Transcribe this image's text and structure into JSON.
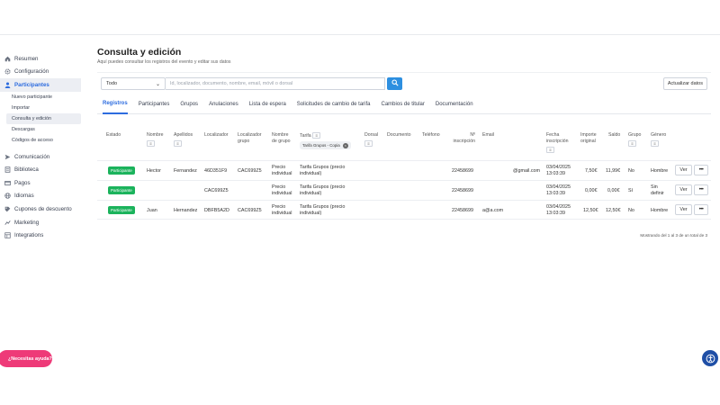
{
  "sidebar": {
    "items": [
      {
        "label": "Resumen",
        "icon": "home-icon"
      },
      {
        "label": "Configuración",
        "icon": "gear-icon"
      },
      {
        "label": "Participantes",
        "icon": "user-icon"
      }
    ],
    "sub_items": [
      "Nuevo participante",
      "Importar",
      "Consulta y edición",
      "Descargas",
      "Códigos de acceso"
    ],
    "items_bottom": [
      {
        "label": "Comunicación",
        "icon": "send-icon"
      },
      {
        "label": "Biblioteca",
        "icon": "book-icon"
      },
      {
        "label": "Pagos",
        "icon": "card-icon"
      },
      {
        "label": "Idiomas",
        "icon": "globe-icon"
      },
      {
        "label": "Cupones de descuento",
        "icon": "coupon-icon"
      },
      {
        "label": "Marketing",
        "icon": "chart-icon"
      },
      {
        "label": "Integrations",
        "icon": "grid-icon"
      }
    ]
  },
  "help_button": "¿Necesitas ayuda?",
  "page": {
    "title": "Consulta y edición",
    "subtitle": "Aquí puedes consultar los registros del evento y editar sus datos"
  },
  "search": {
    "select_value": "Todo",
    "placeholder": "Id, localizador, documento, nombre, email, móvil o dorsal",
    "refresh_label": "Actualizar datos"
  },
  "tabs": [
    "Registros",
    "Participantes",
    "Grupos",
    "Anulaciones",
    "Lista de espera",
    "Solicitudes de cambio de tarifa",
    "Cambios de titular",
    "Documentación"
  ],
  "table": {
    "headers": {
      "estado": "Estado",
      "nombre": "Nombre",
      "apellidos": "Apellidos",
      "localizador": "Localizador",
      "localizador_grupo_1": "Localizador",
      "localizador_grupo_2": "grupo",
      "nombre_grupo_1": "Nombre",
      "nombre_grupo_2": "de grupo",
      "tarifa": "Tarifa",
      "tarifa_chip": "Tarifa Grupos - Copia",
      "dorsal": "Dorsal",
      "documento": "Documento",
      "telefono": "Teléfono",
      "inscripcion_1": "Nº",
      "inscripcion_2": "inscripción",
      "email": "Email",
      "fecha_1": "Fecha",
      "fecha_2": "inscripción",
      "importe_1": "Importe",
      "importe_2": "original",
      "saldo": "Saldo",
      "grupo": "Grupo",
      "genero": "Género"
    },
    "rows": [
      {
        "estado": "Participante",
        "nombre": "Hector",
        "apellidos": "Fernandez",
        "localizador": "46D351F9",
        "loc_grupo": "CAC699Z5",
        "nombre_grupo_1": "Precio",
        "nombre_grupo_2": "individual",
        "tarifa_1": "Tarifa Grupos (precio",
        "tarifa_2": "individual)",
        "inscripcion": "22458699",
        "email": "@gmail.com",
        "fecha_1": "03/04/2025",
        "fecha_2": "13:03:39",
        "importe": "7,50€",
        "saldo": "11,99€",
        "grupo": "No",
        "genero_1": "Hombre",
        "genero_2": "",
        "ver": "Ver",
        "more": "•••"
      },
      {
        "estado": "Participante",
        "nombre": "",
        "apellidos": "",
        "localizador": "CAC699Z5",
        "loc_grupo": "",
        "nombre_grupo_1": "Precio",
        "nombre_grupo_2": "individual",
        "tarifa_1": "Tarifa Grupos (precio",
        "tarifa_2": "individual)",
        "inscripcion": "22458699",
        "email": "",
        "fecha_1": "03/04/2025",
        "fecha_2": "13:03:39",
        "importe": "0,00€",
        "saldo": "0,00€",
        "grupo": "Sí",
        "genero_1": "Sin",
        "genero_2": "definir",
        "ver": "Ver",
        "more": "•••"
      },
      {
        "estado": "Participante",
        "nombre": "Juan",
        "apellidos": "Hernandez",
        "localizador": "DBFB5A2D",
        "loc_grupo": "CAC699Z5",
        "nombre_grupo_1": "Precio",
        "nombre_grupo_2": "individual",
        "tarifa_1": "Tarifa Grupos (precio",
        "tarifa_2": "individual)",
        "inscripcion": "22458699",
        "email": "a@a.com",
        "fecha_1": "03/04/2025",
        "fecha_2": "13:03:39",
        "importe": "12,50€",
        "saldo": "12,50€",
        "grupo": "No",
        "genero_1": "Hombre",
        "genero_2": "",
        "ver": "Ver",
        "more": "•••"
      }
    ],
    "footer": "Mostrando del 1 al 3 de un total de 3"
  },
  "colors": {
    "accent": "#2d6cdf",
    "badge": "#1bb35c",
    "help": "#ee3a78",
    "search_button": "#2d8fe0"
  }
}
